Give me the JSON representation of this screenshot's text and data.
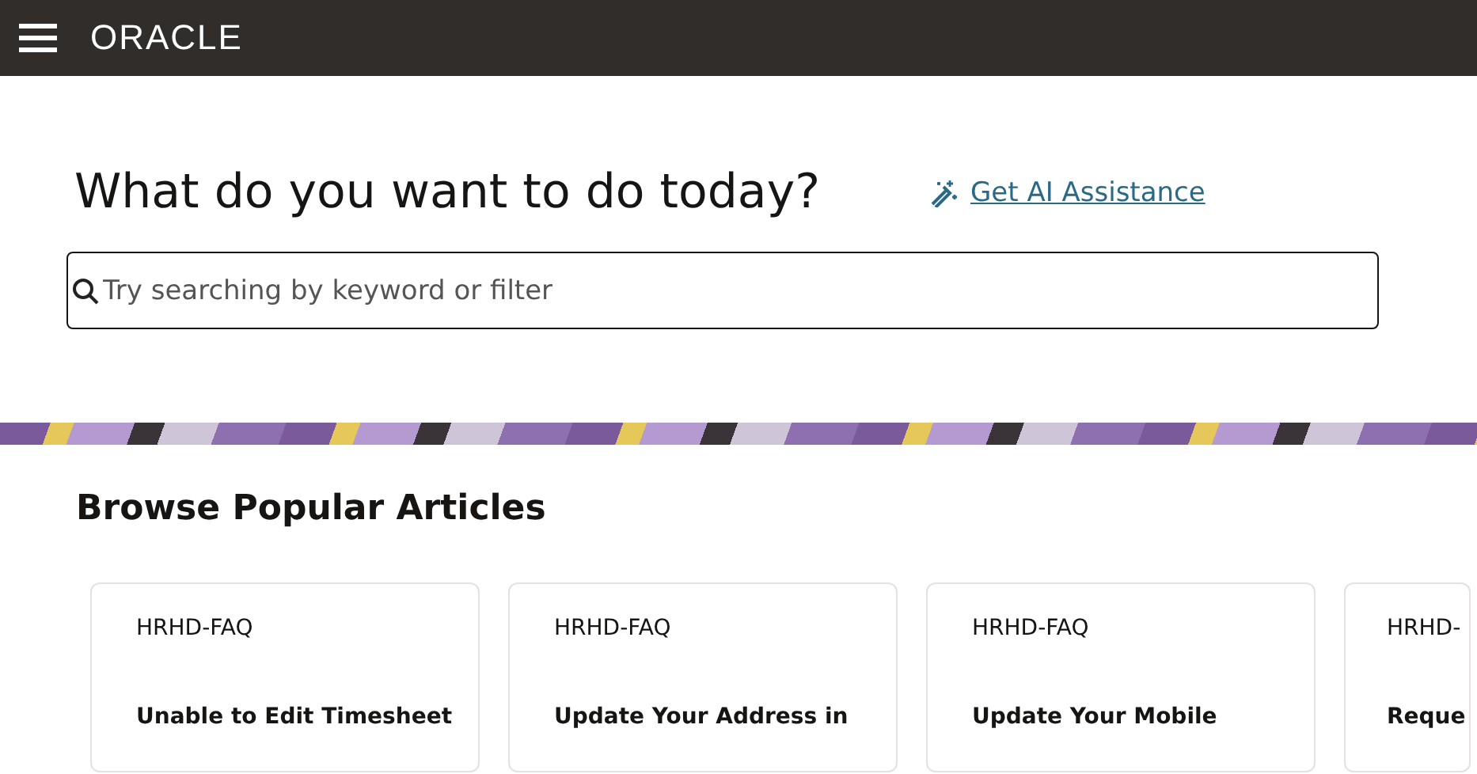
{
  "header": {
    "logo": "ORACLE"
  },
  "hero": {
    "title": "What do you want to do today?",
    "ai_link": "Get AI Assistance"
  },
  "search": {
    "placeholder": "Try searching by keyword or filter"
  },
  "articles": {
    "title": "Browse Popular Articles",
    "cards": [
      {
        "tag": "HRHD-FAQ",
        "title": "Unable to Edit Timesheet"
      },
      {
        "tag": "HRHD-FAQ",
        "title": "Update Your Address in"
      },
      {
        "tag": "HRHD-FAQ",
        "title": "Update Your Mobile"
      },
      {
        "tag": "HRHD-",
        "title": "Reque"
      }
    ]
  }
}
